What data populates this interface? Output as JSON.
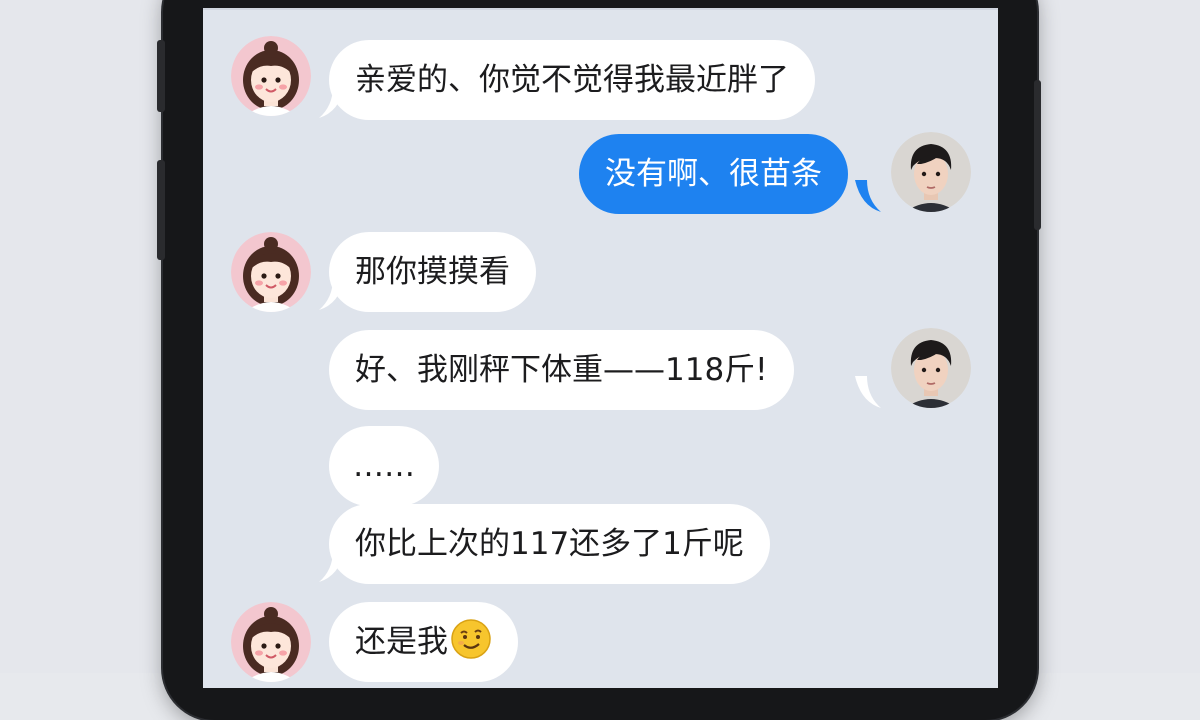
{
  "chat": {
    "messages": [
      {
        "sender": "girlfriend",
        "text": "亲爱的、你觉不觉得我最近胖了"
      },
      {
        "sender": "boyfriend",
        "text": "没有啊、很苗条"
      },
      {
        "sender": "girlfriend",
        "text": "那你摸摸看"
      },
      {
        "sender": "boyfriend",
        "text": "好、我刚秤下体重——118斤!"
      },
      {
        "sender": "boyfriend",
        "text": "……"
      },
      {
        "sender": "boyfriend",
        "text": "你比上次的117还多了1斤呢"
      },
      {
        "sender": "girlfriend",
        "text": "还是我",
        "icon": "smiling-face-emoji"
      }
    ]
  },
  "colors": {
    "sent_bubble": "#1e82f0",
    "received_bubble": "#ffffff",
    "chat_background": "#dfe4ec"
  }
}
